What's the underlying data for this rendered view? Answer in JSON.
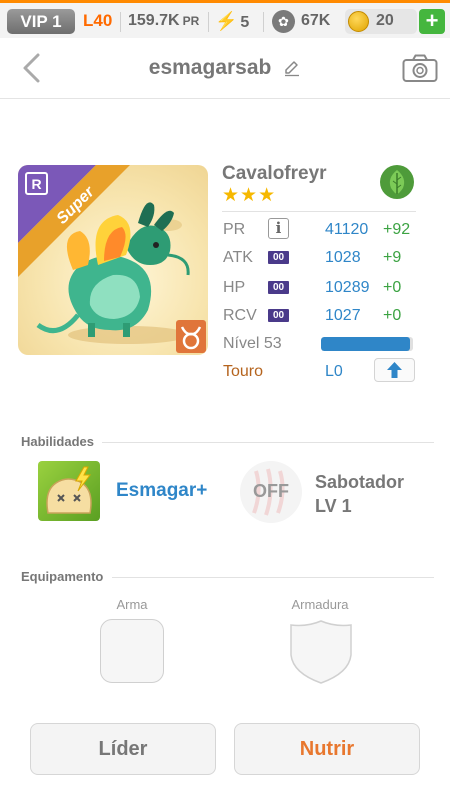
{
  "topbar": {
    "vip": "VIP 1",
    "level": "L40",
    "power": "159.7K",
    "power_unit": "PR",
    "energy": "5",
    "food": "67K",
    "gold": "20",
    "add": "+"
  },
  "header": {
    "player_name": "esmagarsab"
  },
  "dragon": {
    "name": "Cavalofreyr",
    "stars": "★★★",
    "rarity": "Super",
    "stats": [
      {
        "label": "PR",
        "value": "41120",
        "bonus": "+92"
      },
      {
        "label": "ATK",
        "value": "1028",
        "bonus": "+9",
        "icon": "00"
      },
      {
        "label": "HP",
        "value": "10289",
        "bonus": "+0",
        "icon": "00"
      },
      {
        "label": "RCV",
        "value": "1027",
        "bonus": "+0",
        "icon": "00"
      }
    ],
    "level_label": "Nível 53",
    "level_progress": 0.97,
    "zodiac": "Touro",
    "zodiac_level": "L0"
  },
  "abilities": {
    "title": "Habilidades",
    "skill1": "Esmagar+",
    "skill2_state": "OFF",
    "skill2_name": "Sabotador",
    "skill2_level": "LV 1"
  },
  "equipment": {
    "title": "Equipamento",
    "weapon": "Arma",
    "armor": "Armadura"
  },
  "buttons": {
    "leader": "Líder",
    "feed": "Nutrir"
  },
  "colors": {
    "accent": "#ff8a00",
    "blue": "#2f86c8",
    "green": "#3ca343",
    "feed": "#e8772e"
  }
}
